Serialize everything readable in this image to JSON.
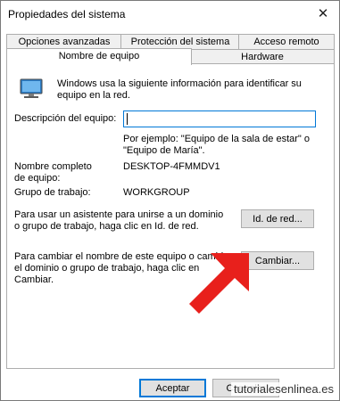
{
  "window": {
    "title": "Propiedades del sistema",
    "close_glyph": "✕"
  },
  "tabs": {
    "row1": [
      "Opciones avanzadas",
      "Protección del sistema",
      "Acceso remoto"
    ],
    "row2": [
      "Nombre de equipo",
      "Hardware"
    ],
    "active": "Nombre de equipo"
  },
  "panel": {
    "intro_text": "Windows usa la siguiente información para identificar su equipo en la red.",
    "description_label": "Descripción del equipo:",
    "description_value": "",
    "example_text": "Por ejemplo: \"Equipo de la sala de estar\" o \"Equipo de María\".",
    "full_name_label": "Nombre completo de equipo:",
    "full_name_value": "DESKTOP-4FMMDV1",
    "workgroup_label": "Grupo de trabajo:",
    "workgroup_value": "WORKGROUP",
    "network_id_text": "Para usar un asistente para unirse a un dominio o grupo de trabajo, haga clic en Id. de red.",
    "network_id_button": "Id. de red...",
    "change_text": "Para cambiar el nombre de este equipo o cambiar el dominio o grupo de trabajo, haga clic en Cambiar.",
    "change_button": "Cambiar..."
  },
  "footer": {
    "accept_button": "Aceptar",
    "cancel_button": "Cancelar"
  },
  "watermark": "tutorialesenlinea.es",
  "colors": {
    "accent": "#0078d7",
    "arrow": "#e8201c",
    "button_bg": "#e1e1e1"
  },
  "icons": {
    "computer": "computer-icon"
  }
}
